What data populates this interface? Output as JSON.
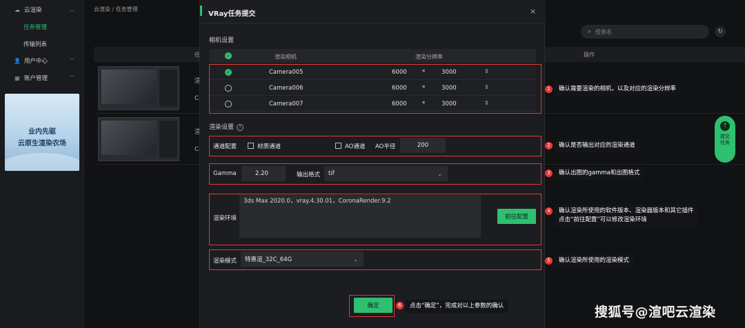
{
  "sidebar": {
    "cloud_render": "云渲染",
    "task_manage": "任务管理",
    "transfer_list": "传输列表",
    "user_center": "用户中心",
    "account_manage": "账户管理",
    "promo_line1": "业内先驱",
    "promo_line2": "云原生渲染农场"
  },
  "background": {
    "breadcrumb": "云渲染 / 任务管理",
    "search_placeholder": "任务名",
    "col_status": "任",
    "col_op": "操作",
    "row1_a": "渲",
    "row1_b": "Ca",
    "row2_a": "渲",
    "row2_b": "Ca",
    "float_line1": "提交",
    "float_line2": "任务"
  },
  "modal": {
    "title": "VRay任务提交",
    "close": "×",
    "camera_section": "相机设置",
    "cam_col_camera": "渲染相机",
    "cam_col_res": "渲染分辨率",
    "cameras": [
      {
        "name": "Camera005",
        "w": "6000",
        "h": "3000",
        "checked": true
      },
      {
        "name": "Camera006",
        "w": "6000",
        "h": "3000",
        "checked": false
      },
      {
        "name": "Camera007",
        "w": "6000",
        "h": "3000",
        "checked": false
      }
    ],
    "times": "*",
    "render_section": "渲染设置",
    "channel_label": "通道配置",
    "material_channel": "材质通道",
    "ao_channel": "AO通道",
    "ao_radius_label": "AO半径",
    "ao_radius_value": "200",
    "gamma_label": "Gamma",
    "gamma_value": "2.20",
    "format_label": "输出格式",
    "format_value": "tif",
    "env_label": "渲染环境",
    "env_value": "3ds Max 2020.0，vray.4.30.01，CoronaRender.9.2",
    "goto_config": "前往配置",
    "mode_label": "渲染模式",
    "mode_value": "特惠渲_32C_64G",
    "confirm": "确定"
  },
  "annotations": [
    {
      "num": "1",
      "text": "确认需要渲染的相机，以及对应的渲染分辨率"
    },
    {
      "num": "2",
      "text": "确认是否输出对应的渲染通道"
    },
    {
      "num": "3",
      "text": "确认出图的gamma和出图格式"
    },
    {
      "num": "4",
      "text_line1": "确认渲染所使用的软件版本、渲染器版本和其它插件",
      "text_line2": "点击“前往配置”可以修改渲染环境"
    },
    {
      "num": "5",
      "text": "确认渲染所使用的渲染模式"
    },
    {
      "num": "6",
      "text": "点击“确定”，完成对以上参数的确认"
    }
  ],
  "watermark": "搜狐号@渲吧云渲染",
  "colors": {
    "accent": "#2fbf71",
    "annotation": "#e53935",
    "bg": "#111214"
  }
}
